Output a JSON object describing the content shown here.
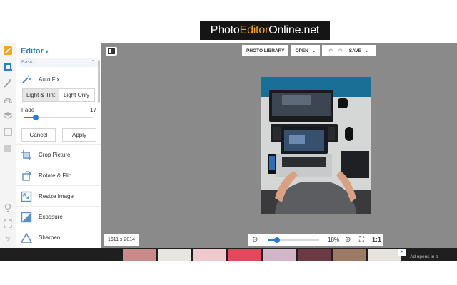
{
  "logo": {
    "part1": "Photo",
    "part2": "Editor",
    "part3": "Online.net"
  },
  "rail": {
    "icons": [
      "logo-icon",
      "crop-icon",
      "magic-wand-icon",
      "hair-icon",
      "layers-icon",
      "frame-icon",
      "texture-icon",
      "lightbulb-icon",
      "fullscreen-icon",
      "help-icon"
    ],
    "help_label": "?"
  },
  "panel": {
    "title": "Editor",
    "section": "Basic",
    "auto_fix": "Auto Fix",
    "modes": [
      "Light & Tint",
      "Light Only"
    ],
    "fade_label": "Fade",
    "fade_value": "17",
    "fade_level": 0.17,
    "cancel": "Cancel",
    "apply": "Apply",
    "tools": [
      "Crop Picture",
      "Rotate & Flip",
      "Resize Image",
      "Exposure",
      "Sharpen"
    ]
  },
  "toolbar": {
    "photo_library": "PHOTO LIBRARY",
    "open": "OPEN",
    "save": "SAVE"
  },
  "canvas": {
    "dimensions": "1611 x 2014",
    "zoom": "18%",
    "zoom_level": 0.18,
    "zoom_minus": "⊖",
    "zoom_plus": "⊕",
    "fit": "⛶",
    "actual": "1:1"
  },
  "ad": {
    "close": "✕",
    "text": "Ad opens in a"
  },
  "colors": {
    "accent": "#2c7bd2",
    "logo_accent": "#f6a623",
    "canvas_bg": "#8a8a8a"
  }
}
